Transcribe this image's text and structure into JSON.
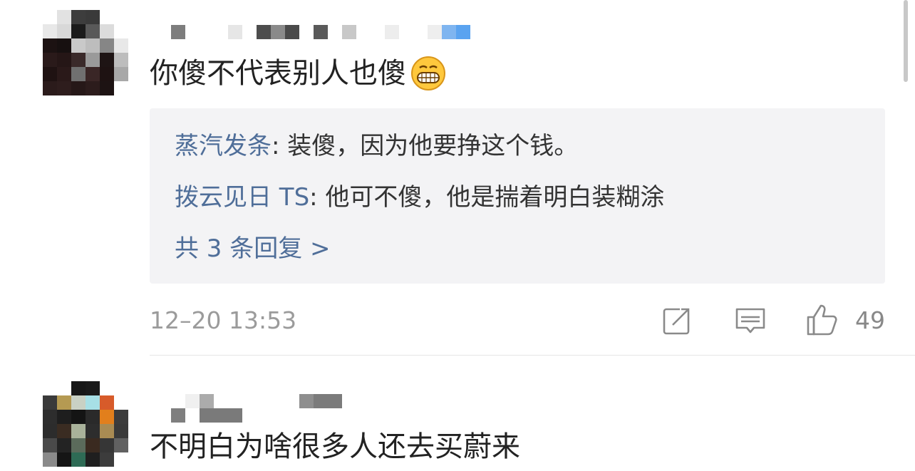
{
  "comments": [
    {
      "text": "你傻不代表别人也傻",
      "emoji": "grinning-teeth-emoji",
      "replies": [
        {
          "author": "蒸汽发条",
          "separator": ": ",
          "text": "装傻，因为他要挣这个钱。"
        },
        {
          "author": "拨云见日 TS",
          "separator": ": ",
          "text": "他可不傻，他是揣着明白装糊涂"
        }
      ],
      "more_replies": "共 3 条回复 >",
      "timestamp": "12–20 13:53",
      "icons": {
        "share": "share-icon",
        "reply": "comment-icon",
        "like": "thumbs-up-icon"
      },
      "like_count": "49"
    },
    {
      "text": "不明白为啥很多人还去买蔚来"
    }
  ],
  "colors": {
    "link": "#4f6e99",
    "reply_box_bg": "#f3f3f5",
    "meta_gray": "#9b9b9b",
    "username_accent": "#5aa3f0"
  }
}
